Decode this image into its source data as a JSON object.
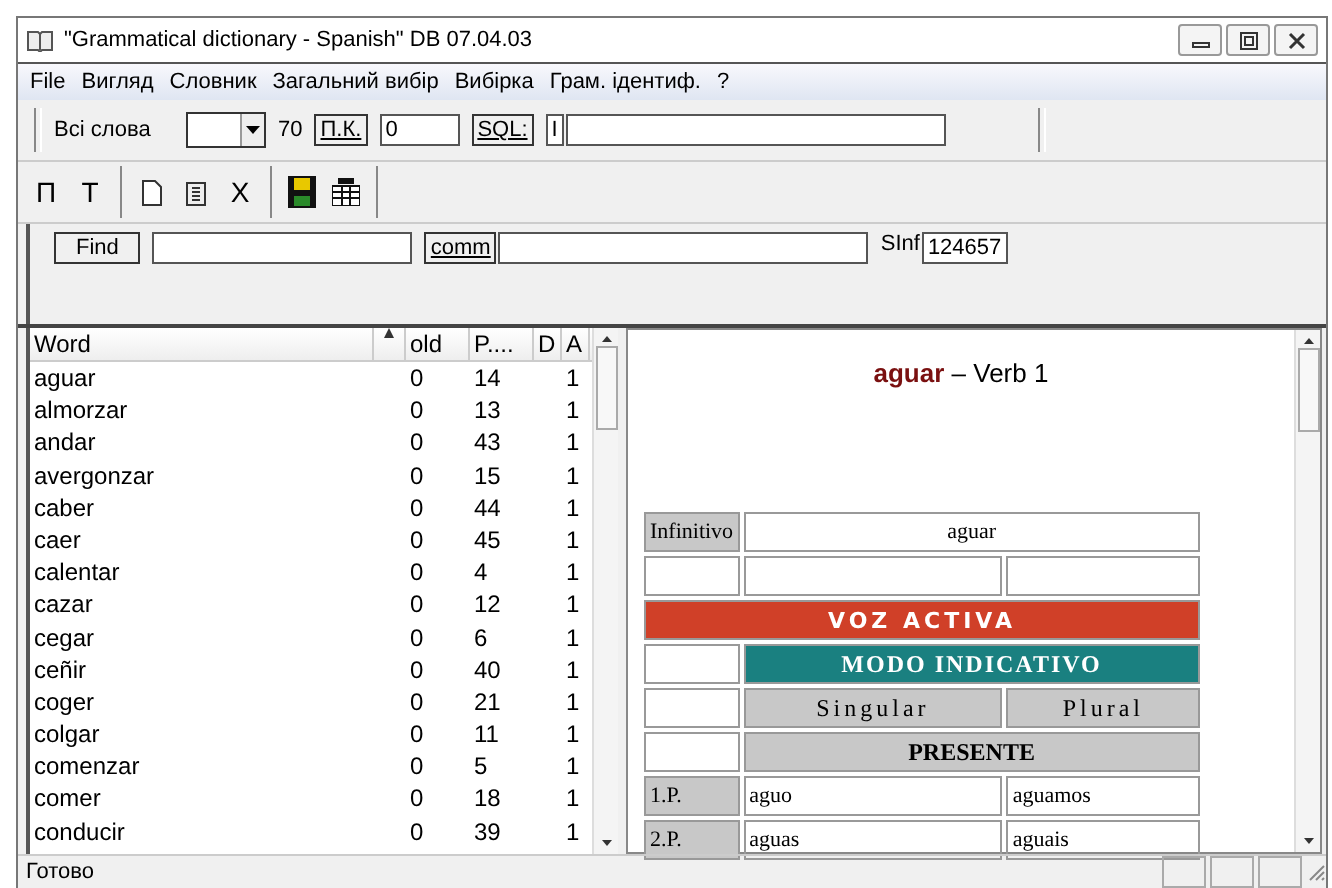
{
  "window": {
    "title": "\"Grammatical dictionary - Spanish\" DB 07.04.03"
  },
  "menu": [
    "File",
    "Вигляд",
    "Словник",
    "Загальний вибір",
    "Вибірка",
    "Грам. ідентиф.",
    "?"
  ],
  "toolbar": {
    "filter_label": "Всі слова",
    "count": "70",
    "pk_button": "П.К.",
    "pk_value": "0",
    "sql_button": "SQL:",
    "sql_prefix": "I"
  },
  "tools": [
    {
      "kind": "text",
      "label": "П"
    },
    {
      "kind": "text",
      "label": "Т"
    },
    {
      "kind": "separator"
    },
    {
      "kind": "new"
    },
    {
      "kind": "clipboard"
    },
    {
      "kind": "text",
      "label": "X"
    },
    {
      "kind": "separator"
    },
    {
      "kind": "save"
    },
    {
      "kind": "grid"
    },
    {
      "kind": "separator"
    }
  ],
  "findbar": {
    "find_button": "Find",
    "comm_button": "comm",
    "sinf_label": "SInf",
    "sinf_value": "124657"
  },
  "word_list": {
    "columns": [
      "Word",
      "old",
      "P....",
      "D",
      "A"
    ],
    "rows": [
      {
        "word": "aguar",
        "old": "0",
        "p": "14",
        "a": "1"
      },
      {
        "word": "almorzar",
        "old": "0",
        "p": "13",
        "a": "1"
      },
      {
        "word": "andar",
        "old": "0",
        "p": "43",
        "a": "1"
      },
      {
        "word": "avergonzar",
        "old": "0",
        "p": "15",
        "a": "1"
      },
      {
        "word": "caber",
        "old": "0",
        "p": "44",
        "a": "1"
      },
      {
        "word": "caer",
        "old": "0",
        "p": "45",
        "a": "1"
      },
      {
        "word": "calentar",
        "old": "0",
        "p": "4",
        "a": "1"
      },
      {
        "word": "cazar",
        "old": "0",
        "p": "12",
        "a": "1"
      },
      {
        "word": "cegar",
        "old": "0",
        "p": "6",
        "a": "1"
      },
      {
        "word": "ceñir",
        "old": "0",
        "p": "40",
        "a": "1"
      },
      {
        "word": "coger",
        "old": "0",
        "p": "21",
        "a": "1"
      },
      {
        "word": "colgar",
        "old": "0",
        "p": "11",
        "a": "1"
      },
      {
        "word": "comenzar",
        "old": "0",
        "p": "5",
        "a": "1"
      },
      {
        "word": "comer",
        "old": "0",
        "p": "18",
        "a": "1"
      },
      {
        "word": "conducir",
        "old": "0",
        "p": "39",
        "a": "1"
      }
    ]
  },
  "article": {
    "word": "aguar",
    "title_rest": "– Verb 1",
    "table": [
      {
        "kind": "pair",
        "label": "Infinitivo",
        "value": "aguar"
      },
      {
        "kind": "blank"
      },
      {
        "kind": "voice",
        "text": "VOZ ACTIVA"
      },
      {
        "kind": "mood",
        "text": "MODO INDICATIVO"
      },
      {
        "kind": "numbers",
        "singular": "Singular",
        "plural": "Plural"
      },
      {
        "kind": "tense",
        "text": "PRESENTE"
      },
      {
        "kind": "form",
        "person": "1.P.",
        "singular": "aguo",
        "plural": "aguamos"
      },
      {
        "kind": "form",
        "person": "2.P.",
        "singular": "aguas",
        "plural": "aguais"
      }
    ]
  },
  "status_bar": {
    "text": "Готово"
  }
}
